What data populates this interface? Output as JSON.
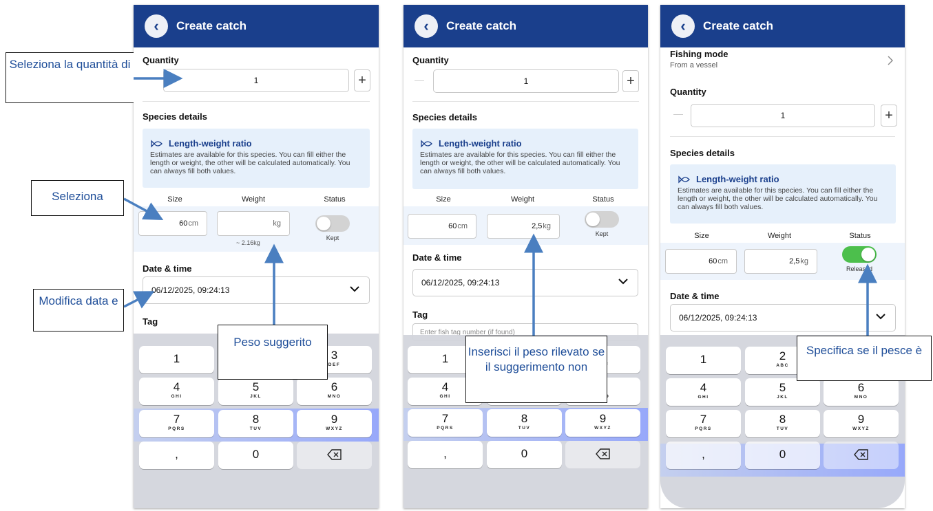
{
  "header": {
    "title": "Create catch",
    "back_icon": "chevron-left-icon"
  },
  "common": {
    "quantity_label": "Quantity",
    "species_details_label": "Species details",
    "info_title": "Length-weight ratio",
    "info_text": "Estimates are available for this species. You can fill either the length or weight, the other will be calculated automatically. You can always fill both values.",
    "col_size": "Size",
    "col_weight": "Weight",
    "col_status": "Status",
    "date_label": "Date & time",
    "date_value": "06/12/2025, 09:24:13",
    "tag_label": "Tag",
    "tag_placeholder": "Enter fish tag number (if found)",
    "cm": "cm",
    "kg": "kg"
  },
  "screen1": {
    "quantity": "1",
    "size": "60",
    "weight": "",
    "weight_hint": "~ 2.16kg",
    "status": "Kept"
  },
  "screen2": {
    "quantity": "1",
    "size": "60",
    "weight": "2,5",
    "status": "Kept"
  },
  "screen3": {
    "fishing_mode_label": "Fishing mode",
    "fishing_mode_value": "From a vessel",
    "quantity": "1",
    "size": "60",
    "weight": "2,5",
    "status": "Released"
  },
  "keypad": {
    "keys": [
      {
        "d": "1",
        "s": ""
      },
      {
        "d": "2",
        "s": "ABC"
      },
      {
        "d": "3",
        "s": "DEF"
      },
      {
        "d": "4",
        "s": "GHI"
      },
      {
        "d": "5",
        "s": "JKL"
      },
      {
        "d": "6",
        "s": "MNO"
      },
      {
        "d": "7",
        "s": "PQRS"
      },
      {
        "d": "8",
        "s": "TUV"
      },
      {
        "d": "9",
        "s": "WXYZ"
      },
      {
        "d": ",",
        "s": ""
      },
      {
        "d": "0",
        "s": ""
      },
      {
        "d": "",
        "s": ""
      }
    ]
  },
  "callouts": {
    "c1": "Seleziona la quantità di",
    "c2": "Seleziona",
    "c3": "Modifica data e",
    "c4": "Peso suggerito",
    "c5": "Inserisci il peso rilevato se il suggerimento non",
    "c6": "Specifica se il pesce è"
  },
  "colors": {
    "appbar": "#1a3f8c",
    "callout_text": "#1f4e99",
    "arrow": "#4a7fc0",
    "toggle_on": "#4cbf4c",
    "toggle_off": "#d3d3d3"
  }
}
